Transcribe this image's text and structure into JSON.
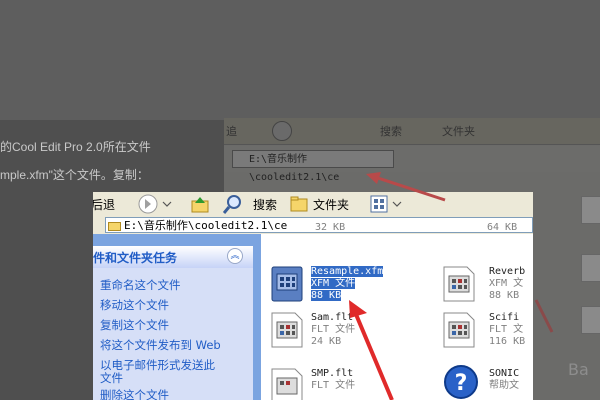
{
  "background": {
    "text_lines": [
      "的Cool Edit Pro 2.0所在文件",
      "mple.xfm\"这个文件。复制："
    ],
    "toolbar": {
      "back": "追",
      "search": "搜索",
      "folders": "文件夹"
    },
    "address": "E:\\音乐制作\\cooledit2.1\\ce",
    "watermark": "Ba"
  },
  "toolbar": {
    "back_label": "后退",
    "search_label": "搜索",
    "folders_label": "文件夹"
  },
  "address": {
    "path": "E:\\音乐制作\\cooledit2.1\\ce"
  },
  "tasks": {
    "title": "件和文件夹任务",
    "collapse_glyph": "︽",
    "items": [
      "重命名这个文件",
      "移动这个文件",
      "复制这个文件",
      "将这个文件发布到 Web",
      "以电子邮件形式发送此",
      "文件",
      "删除这个文件"
    ]
  },
  "files": [
    {
      "name": "",
      "type": "",
      "size": "32 KB"
    },
    {
      "name": "",
      "type": "",
      "size": "64 KB"
    },
    {
      "name": "Resample.xfm",
      "type": "XFM 文件",
      "size": "88 KB",
      "selected": true
    },
    {
      "name": "Reverb",
      "type": "XFM 文",
      "size": "88 KB"
    },
    {
      "name": "Sam.flt",
      "type": "FLT 文件",
      "size": "24 KB"
    },
    {
      "name": "Scifi",
      "type": "FLT 文",
      "size": "116 KB"
    },
    {
      "name": "SMP.flt",
      "type": "FLT 文件",
      "size": ""
    },
    {
      "name": "SONIC",
      "type": "帮助文",
      "size": ""
    }
  ],
  "colors": {
    "selection": "#316ac5",
    "task_text": "#215dc6",
    "arrow": "#e02a2a"
  }
}
